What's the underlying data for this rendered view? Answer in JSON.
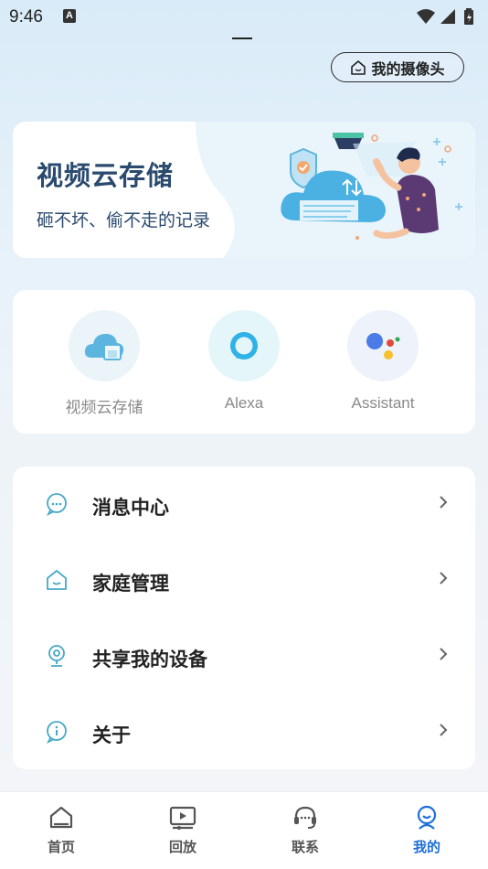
{
  "status": {
    "time": "9:46",
    "a_badge": "A"
  },
  "header": {
    "my_camera_label": "我的摄像头"
  },
  "banner": {
    "title": "视频云存储",
    "subtitle": "砸不坏、偷不走的记录"
  },
  "services": [
    {
      "label": "视频云存储",
      "icon": "cloud-storage-icon"
    },
    {
      "label": "Alexa",
      "icon": "alexa-icon"
    },
    {
      "label": "Assistant",
      "icon": "google-assistant-icon"
    }
  ],
  "menu": [
    {
      "label": "消息中心",
      "icon": "message-icon"
    },
    {
      "label": "家庭管理",
      "icon": "home-icon"
    },
    {
      "label": "共享我的设备",
      "icon": "camera-share-icon"
    },
    {
      "label": "关于",
      "icon": "info-icon"
    }
  ],
  "tabs": [
    {
      "label": "首页",
      "icon": "home-tab-icon"
    },
    {
      "label": "回放",
      "icon": "playback-icon"
    },
    {
      "label": "联系",
      "icon": "headset-icon"
    },
    {
      "label": "我的",
      "icon": "profile-icon",
      "active": true
    }
  ],
  "colors": {
    "accent": "#1e6fd9",
    "title_blue": "#2a4a6e",
    "icon_teal": "#45a9c7"
  }
}
